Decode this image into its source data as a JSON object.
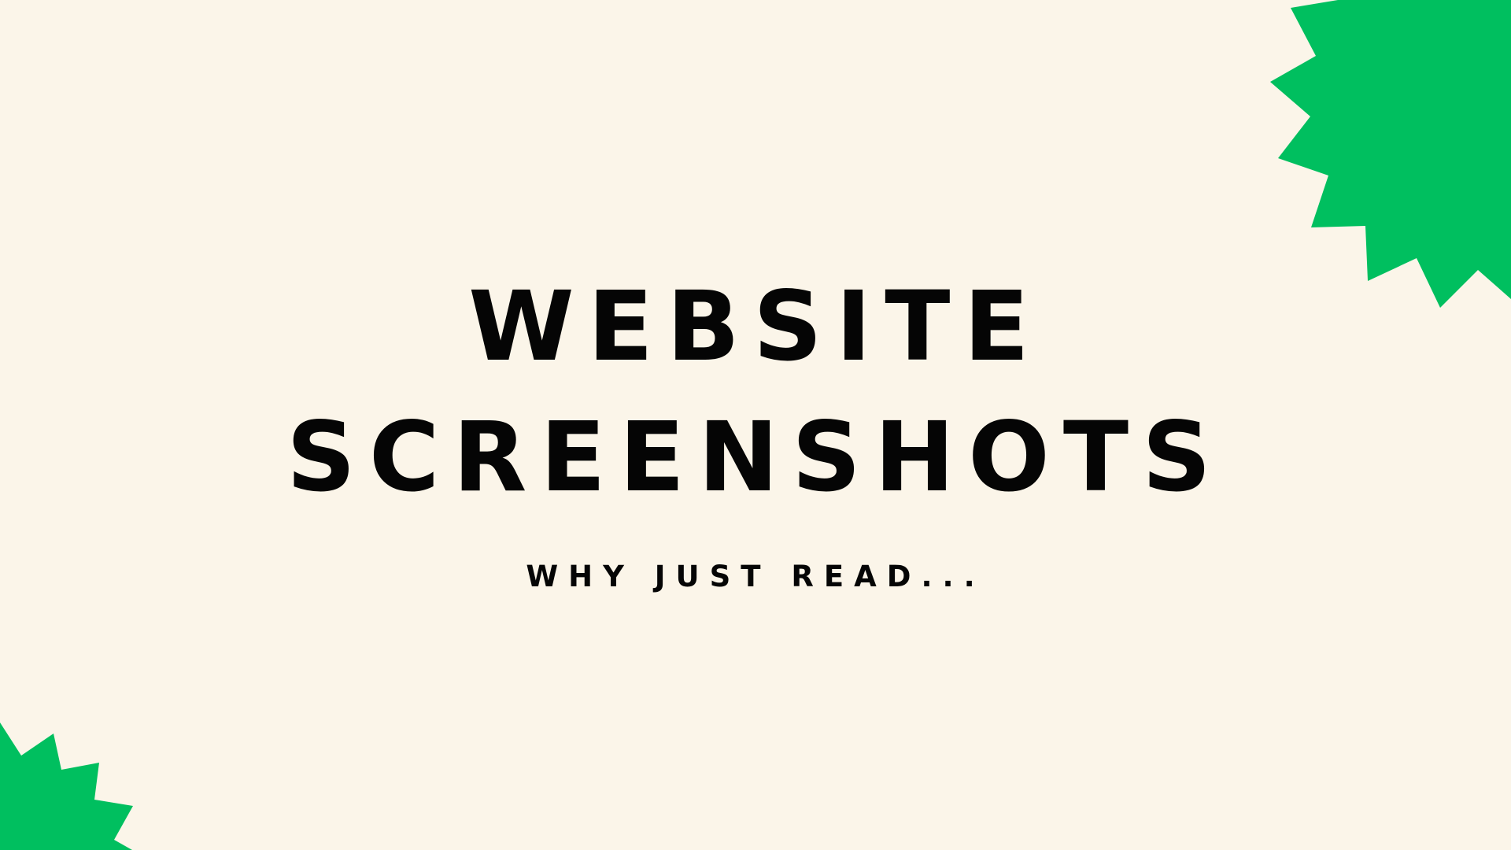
{
  "title": {
    "line_1": "WEBSITE",
    "line_2": "SCREENSHOTS"
  },
  "subtitle": "WHY JUST READ...",
  "colors": {
    "background": "#fbf5e9",
    "accent": "#00bf5f",
    "text": "#050505"
  },
  "decorations": {
    "top_right": "green-starburst-shape",
    "bottom_left": "green-starburst-shape"
  }
}
